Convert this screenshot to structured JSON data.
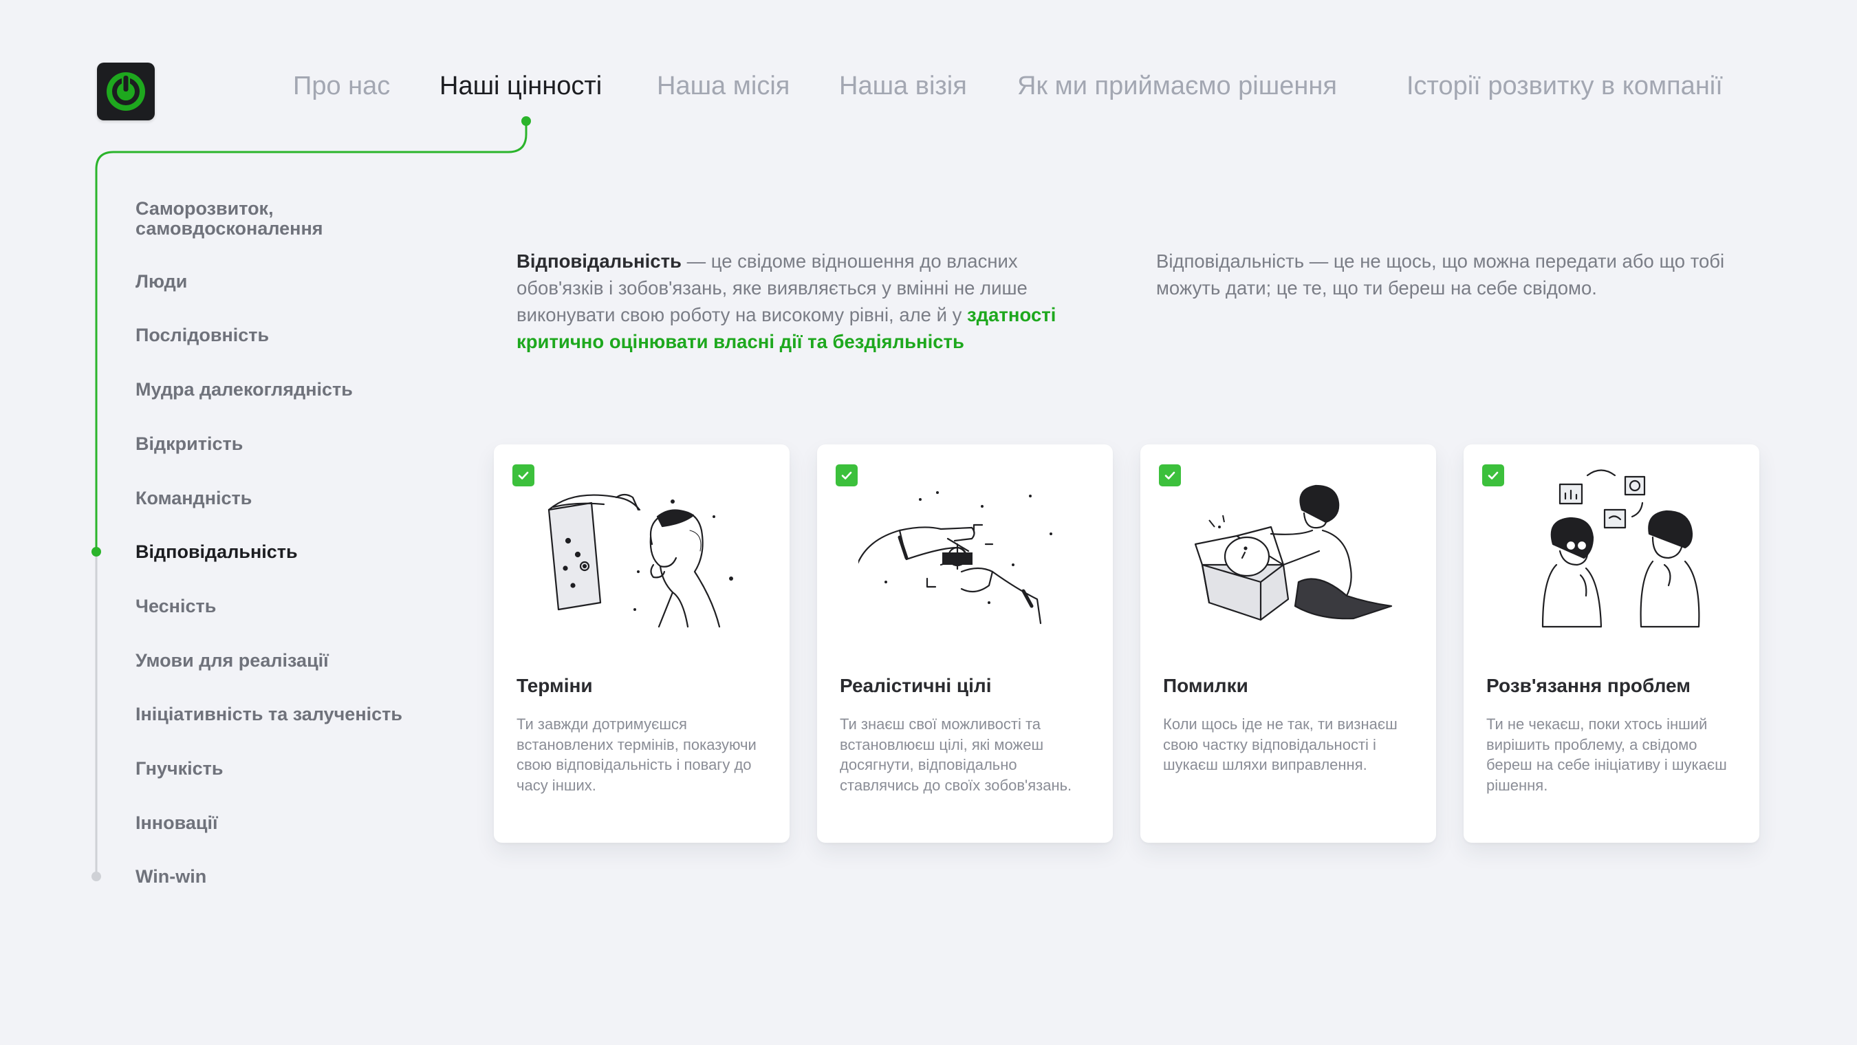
{
  "nav": {
    "items": [
      "Про нас",
      "Наші цінності",
      "Наша місія",
      "Наша візія",
      "Як ми приймаємо рішення",
      "Історії розвитку в компанії"
    ],
    "active_index": 1
  },
  "sidebar": {
    "items": [
      "Саморозвиток, самовдосконалення",
      "Люди",
      "Послідовність",
      "Мудра далекоглядність",
      "Відкритість",
      "Командність",
      "Відповідальність",
      "Чесність",
      "Умови для реалізації",
      "Ініціативність та залученість",
      "Гнучкість",
      "Інновації",
      "Win-win"
    ],
    "active_index": 6
  },
  "intro": {
    "term": "Відповідальність",
    "definition": " — це свідоме відношення до власних обов'язків і зобов'язань, яке виявляється у вмінні не лише виконувати свою роботу на високому рівні, але й у ",
    "highlight": "здатності критично оцінювати власні дії та бездіяльність",
    "quote": "Відповідальність — це не щось, що можна передати або що тобі можуть дати; це те, що ти береш на себе свідомо."
  },
  "cards": [
    {
      "title": "Терміни",
      "text": "Ти завжди дотримуєшся встановлених термінів, показуючи свою відповідальність і повагу до часу інших.",
      "icon": "woman-checking-calendar-illustration"
    },
    {
      "title": "Реалістичні цілі",
      "text": "Ти знаєш свої можливості та встановлюєш цілі, які можеш досягнути, відповідально ставлячись до своїх зобов'язань.",
      "icon": "hands-target-illustration"
    },
    {
      "title": "Помилки",
      "text": "Коли щось іде не так, ти визнаєш свою частку відповідальності і шукаєш шляхи виправлення.",
      "icon": "woman-opening-box-illustration"
    },
    {
      "title": "Розв'язання проблем",
      "text": "Ти не чекаєш, поки хтось інший вирішить проблему, а свідомо береш на себе ініціативу і шукаєш рішення.",
      "icon": "two-people-thinking-illustration"
    }
  ],
  "colors": {
    "accent": "#1ea81e",
    "check": "#3cc03c",
    "background": "#f2f3f7",
    "logo_bg": "#1c1d20"
  }
}
